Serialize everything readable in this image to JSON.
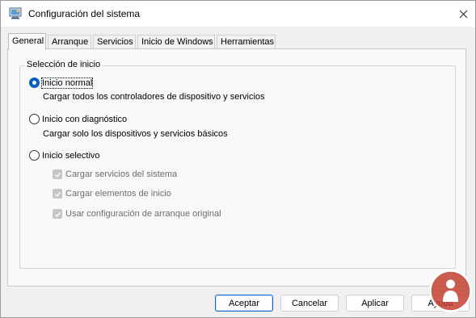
{
  "window": {
    "title": "Configuración del sistema"
  },
  "tabs": [
    {
      "label": "General",
      "active": true
    },
    {
      "label": "Arranque",
      "active": false
    },
    {
      "label": "Servicios",
      "active": false
    },
    {
      "label": "Inicio de Windows",
      "active": false
    },
    {
      "label": "Herramientas",
      "active": false
    }
  ],
  "startup_selection": {
    "legend": "Selección de inicio",
    "options": [
      {
        "label": "Inicio normal",
        "description": "Cargar todos los controladores de dispositivo y servicios",
        "checked": true
      },
      {
        "label": "Inicio con diagnóstico",
        "description": "Cargar solo los dispositivos y servicios básicos",
        "checked": false
      },
      {
        "label": "Inicio selectivo",
        "checked": false
      }
    ],
    "selective_options": [
      {
        "label": "Cargar servicios del sistema",
        "checked": true,
        "enabled": false
      },
      {
        "label": "Cargar elementos de inicio",
        "checked": true,
        "enabled": false
      },
      {
        "label": "Usar configuración de arranque original",
        "checked": true,
        "enabled": false
      }
    ]
  },
  "buttons": {
    "accept": "Aceptar",
    "cancel": "Cancelar",
    "apply": "Aplicar",
    "help": "Ayuda"
  },
  "colors": {
    "accent": "#0a5fc2",
    "watermark": "#c0392b"
  },
  "icons": {
    "app": "system-config-icon",
    "close": "close-icon",
    "watermark": "solvetic-logo"
  }
}
